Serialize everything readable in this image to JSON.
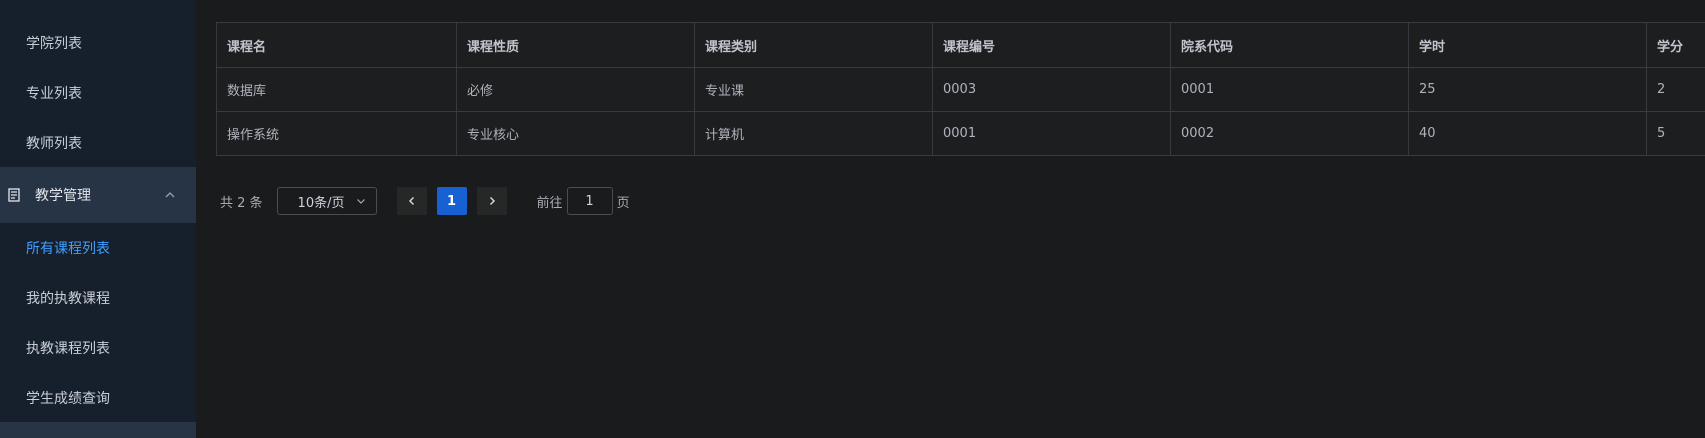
{
  "sidebar": {
    "items_top": [
      "学院列表",
      "专业列表",
      "教师列表"
    ],
    "group": {
      "label": "教学管理"
    },
    "items_sub": [
      "所有课程列表",
      "我的执教课程",
      "执教课程列表",
      "学生成绩查询"
    ],
    "active_color": "#409eff"
  },
  "table": {
    "headers": [
      "课程名",
      "课程性质",
      "课程类别",
      "课程编号",
      "院系代码",
      "学时",
      "学分"
    ],
    "rows": [
      [
        "数据库",
        "必修",
        "专业课",
        "0003",
        "0001",
        "25",
        "2"
      ],
      [
        "操作系统",
        "专业核心",
        "计算机",
        "0001",
        "0002",
        "40",
        "5"
      ]
    ]
  },
  "pagination": {
    "total": "共 2 条",
    "page_size": "10条/页",
    "current_page": "1",
    "goto_prefix": "前往",
    "goto_value": "1",
    "goto_suffix": "页",
    "accent": "#1861d3"
  }
}
